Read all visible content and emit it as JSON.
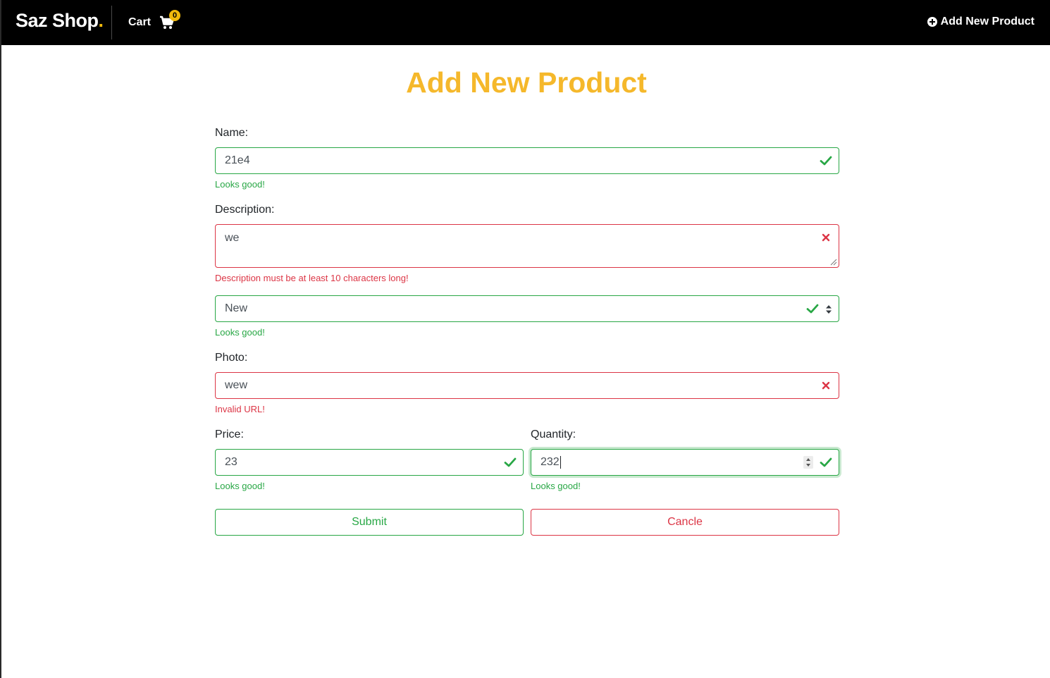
{
  "nav": {
    "brand": "Saz Shop",
    "brand_dot": ".",
    "cart_label": "Cart",
    "cart_count": "0",
    "add_label": "Add New Product"
  },
  "page": {
    "title": "Add New Product"
  },
  "form": {
    "name": {
      "label": "Name:",
      "value": "21e4",
      "feedback": "Looks good!",
      "state": "valid"
    },
    "description": {
      "label": "Description:",
      "value": "we",
      "feedback": "Description must be at least 10 characters long!",
      "state": "invalid"
    },
    "condition": {
      "value": "New",
      "feedback": "Looks good!",
      "state": "valid"
    },
    "photo": {
      "label": "Photo:",
      "value": "wew",
      "feedback": "Invalid URL!",
      "state": "invalid"
    },
    "price": {
      "label": "Price:",
      "value": "23",
      "feedback": "Looks good!",
      "state": "valid"
    },
    "quantity": {
      "label": "Quantity:",
      "value": "232",
      "feedback": "Looks good!",
      "state": "valid"
    },
    "submit_label": "Submit",
    "cancel_label": "Cancle"
  },
  "colors": {
    "accent": "#f5b82b",
    "valid": "#28a745",
    "invalid": "#dc3545",
    "navbar": "#000000"
  },
  "icons": [
    "cart-icon",
    "plus-circle-icon",
    "check-icon",
    "x-icon",
    "sort-arrows-icon",
    "spinner-arrows-icon"
  ]
}
